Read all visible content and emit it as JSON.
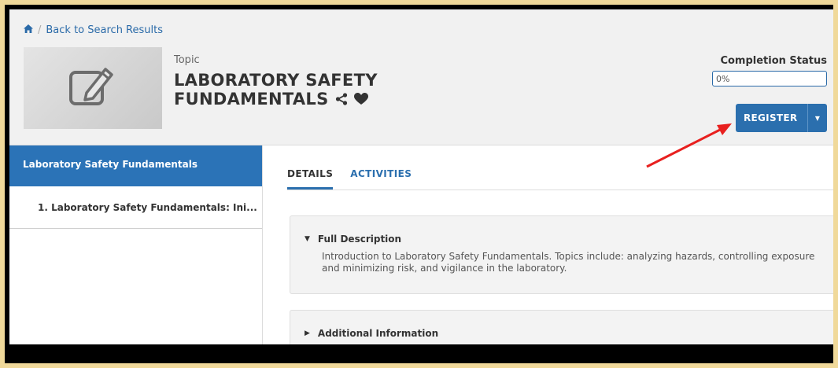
{
  "breadcrumb": {
    "home_icon": "home-icon",
    "separator": "/",
    "back_link": "Back to Search Results"
  },
  "header": {
    "type_label": "Topic",
    "title": "LABORATORY SAFETY FUNDAMENTALS",
    "thumbnail_icon": "edit-icon",
    "share_icon": "share-icon",
    "favorite_icon": "heart-icon",
    "completion_label": "Completion Status",
    "completion_value": "0%",
    "register_label": "REGISTER",
    "register_caret": "▾"
  },
  "sidebar": {
    "items": [
      {
        "label": "Laboratory Safety Fundamentals",
        "active": true
      },
      {
        "label": "1. Laboratory Safety Fundamentals: Ini...",
        "active": false
      }
    ]
  },
  "tabs": [
    {
      "label": "DETAILS",
      "active": true
    },
    {
      "label": "ACTIVITIES",
      "active": false
    }
  ],
  "panels": [
    {
      "title": "Full Description",
      "expanded": true,
      "body": "Introduction to Laboratory Safety Fundamentals. Topics include: analyzing hazards, controlling exposure and minimizing risk, and vigilance in the laboratory."
    },
    {
      "title": "Additional Information",
      "expanded": false
    }
  ],
  "colors": {
    "accent": "#2b6fae",
    "sidebar_active": "#2b73b7",
    "annotation_arrow": "#e8201f",
    "outer_border": "#f0d99a"
  }
}
